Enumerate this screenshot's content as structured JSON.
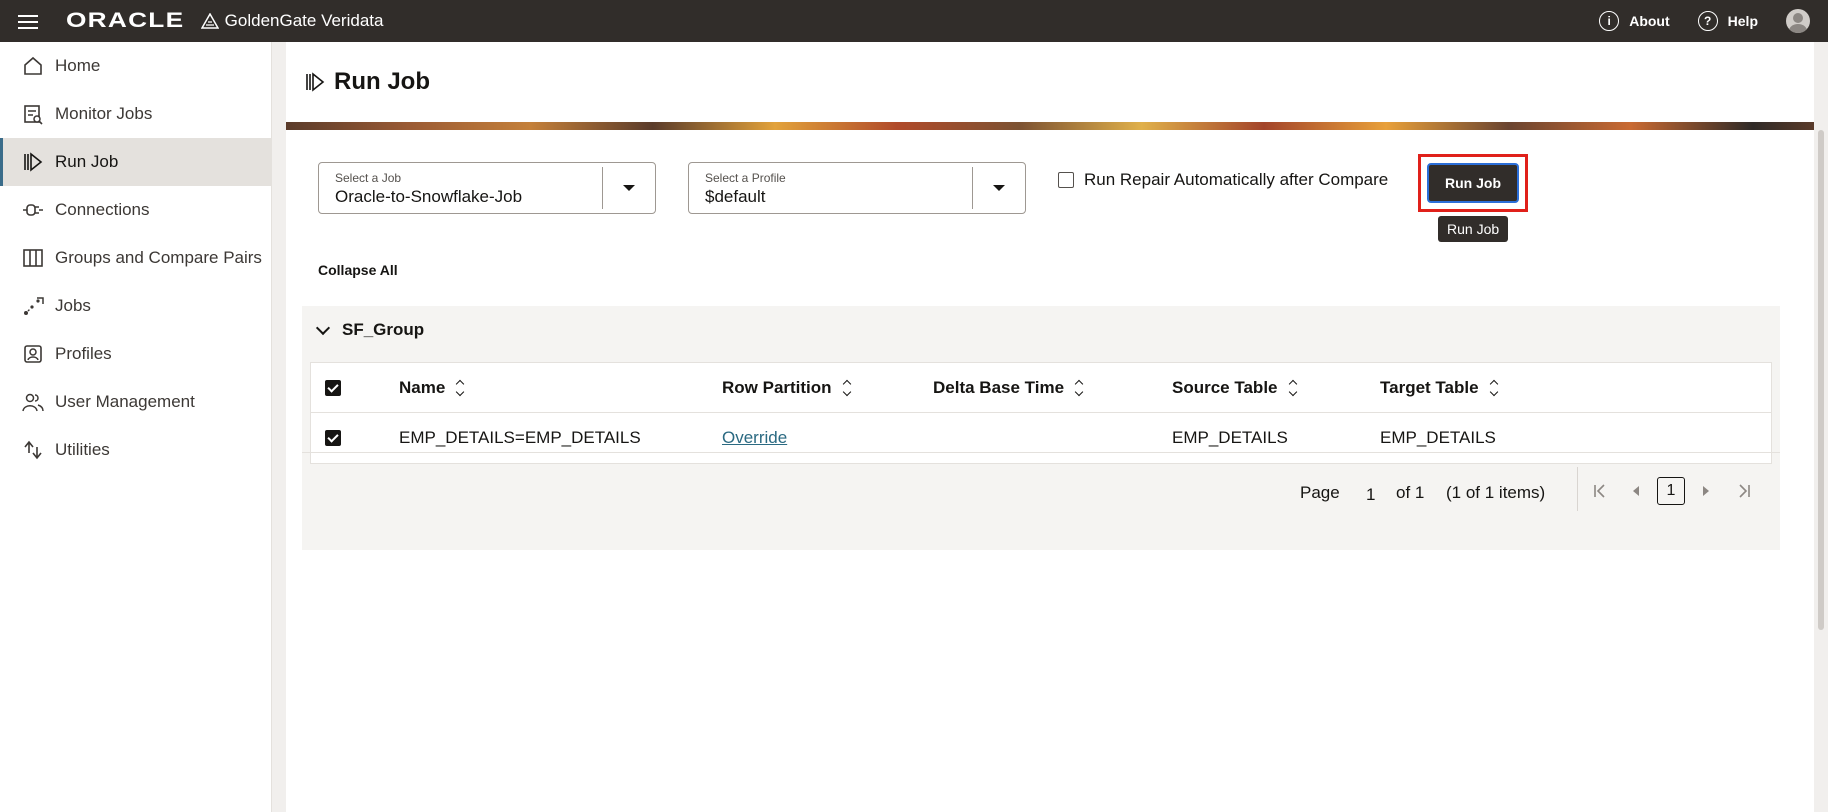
{
  "topbar": {
    "brand": "ORACLE",
    "product": "GoldenGate Veridata",
    "about": "About",
    "help": "Help"
  },
  "sidebar": {
    "items": [
      {
        "label": "Home",
        "icon": "home-icon"
      },
      {
        "label": "Monitor Jobs",
        "icon": "monitor-icon"
      },
      {
        "label": "Run Job",
        "icon": "run-job-icon",
        "active": true
      },
      {
        "label": "Connections",
        "icon": "plug-icon"
      },
      {
        "label": "Groups and Compare Pairs",
        "icon": "columns-icon"
      },
      {
        "label": "Jobs",
        "icon": "jobs-icon"
      },
      {
        "label": "Profiles",
        "icon": "profile-icon"
      },
      {
        "label": "User Management",
        "icon": "users-icon"
      },
      {
        "label": "Utilities",
        "icon": "utilities-icon"
      }
    ]
  },
  "page": {
    "title": "Run Job"
  },
  "form": {
    "job_label": "Select a Job",
    "job_value": "Oracle-to-Snowflake-Job",
    "profile_label": "Select a Profile",
    "profile_value": "$default",
    "repair_label": "Run Repair Automatically after Compare",
    "run_button": "Run Job",
    "tooltip": "Run Job",
    "collapse_all": "Collapse All"
  },
  "group": {
    "name": "SF_Group",
    "columns": {
      "name": "Name",
      "row_partition": "Row Partition",
      "delta_base_time": "Delta Base Time",
      "source_table": "Source Table",
      "target_table": "Target Table"
    },
    "rows": [
      {
        "name": "EMP_DETAILS=EMP_DETAILS",
        "row_partition": "Override",
        "delta_base_time": "",
        "source_table": "EMP_DETAILS",
        "target_table": "EMP_DETAILS"
      }
    ]
  },
  "pager": {
    "page_label": "Page",
    "page_value": "1",
    "of_label": "of 1",
    "items_label": "(1 of 1 items)",
    "current": "1"
  },
  "colors": {
    "topbar": "#312d2a",
    "highlight": "#e0201a",
    "link": "#2b6a82"
  }
}
